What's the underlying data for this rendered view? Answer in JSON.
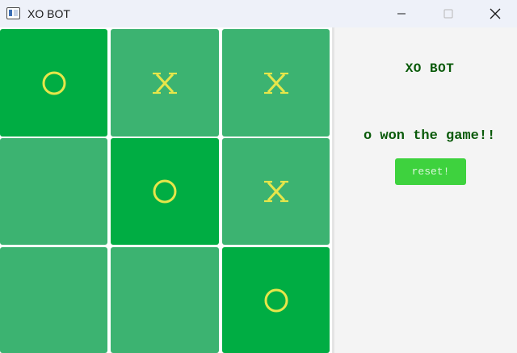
{
  "window": {
    "title": "XO BOT"
  },
  "board": {
    "cells": [
      {
        "mark": "O",
        "winning": true
      },
      {
        "mark": "X",
        "winning": false
      },
      {
        "mark": "X",
        "winning": false
      },
      {
        "mark": "",
        "winning": false
      },
      {
        "mark": "O",
        "winning": true
      },
      {
        "mark": "X",
        "winning": false
      },
      {
        "mark": "",
        "winning": false
      },
      {
        "mark": "",
        "winning": false
      },
      {
        "mark": "O",
        "winning": true
      }
    ]
  },
  "panel": {
    "title": "XO BOT",
    "status": "o won the game!!",
    "reset_label": "reset!"
  },
  "colors": {
    "cell": "#3cb371",
    "cell_winning": "#00ad43",
    "mark": "#e6e64a",
    "text": "#0a5a0a",
    "reset_button": "#3ed23e"
  }
}
